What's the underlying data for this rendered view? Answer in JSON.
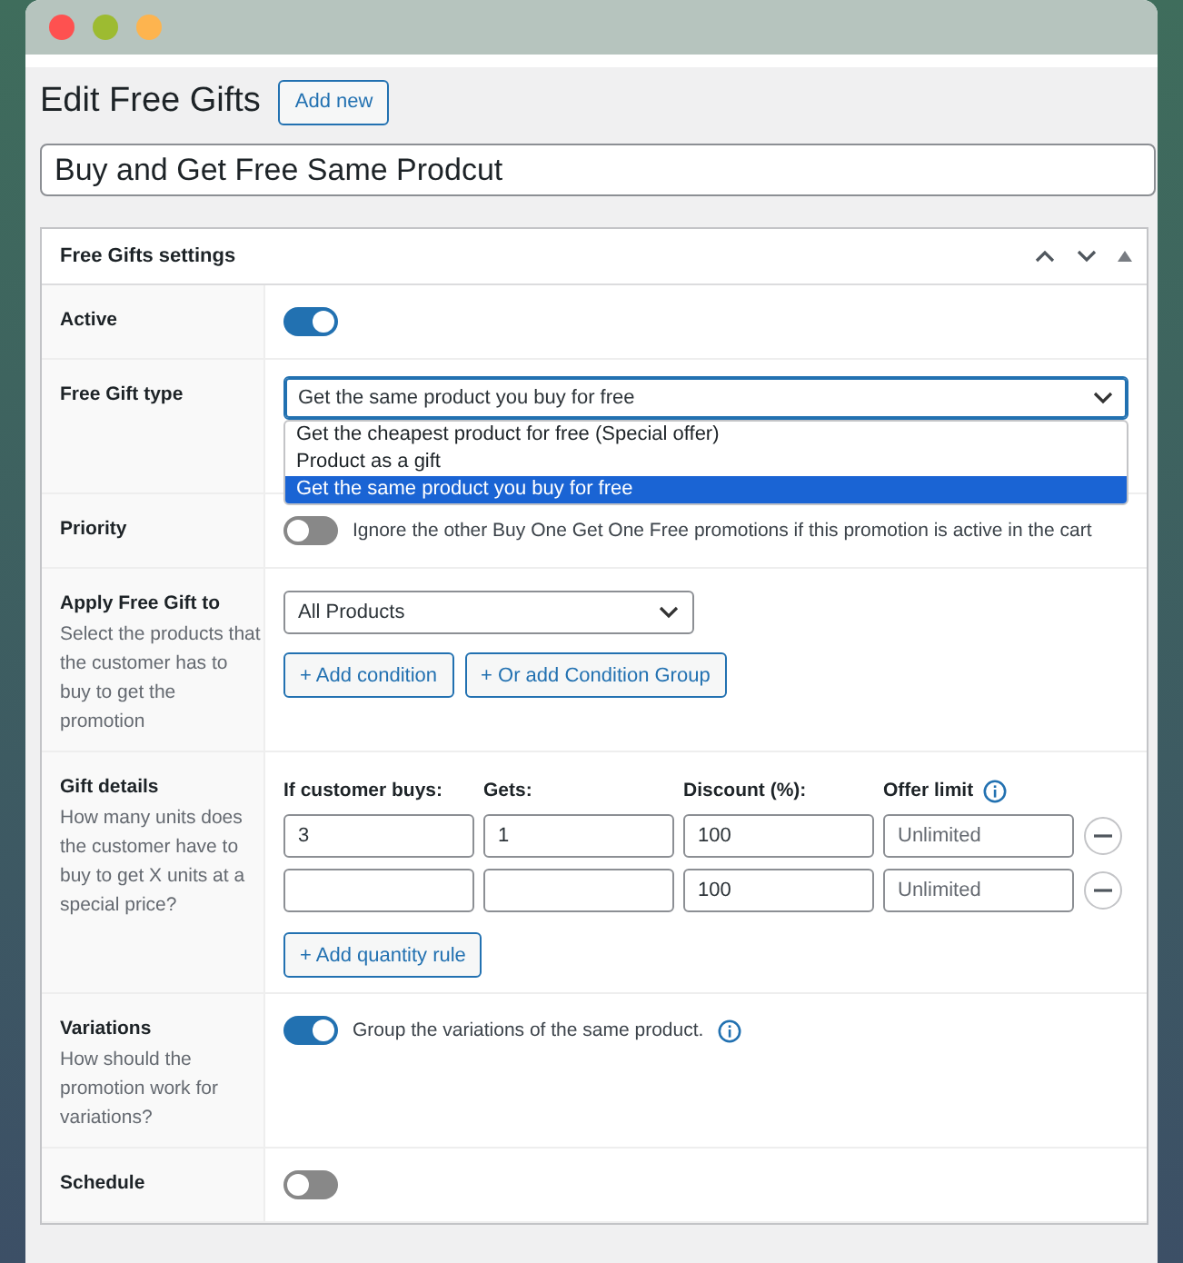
{
  "heading": "Edit Free Gifts",
  "add_new_button": "Add new",
  "post_title": "Buy and Get Free Same Prodcut",
  "settings": {
    "title": "Free Gifts settings",
    "rows": [
      {
        "kind": "toggle",
        "label": "Active",
        "on": true
      },
      {
        "kind": "select",
        "label": "Free Gift type",
        "value": "Get the same product you buy for free",
        "expanded": true,
        "options": [
          {
            "label": "Get the cheapest product for free (Special offer)",
            "selected": false
          },
          {
            "label": "Product as a gift",
            "selected": false
          },
          {
            "label": "Get the same product you buy for free",
            "selected": true
          }
        ]
      },
      {
        "kind": "toggle",
        "label": "Priority",
        "on": false,
        "text": "Ignore the other Buy One Get One Free promotions if this promotion is active in the cart"
      },
      {
        "kind": "conditions",
        "label": "Apply Free Gift to",
        "description": "Select the products that the customer has to buy to get the promotion",
        "select": "All Products",
        "buttons": [
          "+ Add condition",
          "+ Or add Condition Group"
        ]
      },
      {
        "kind": "rules",
        "label": "Gift details",
        "description": "How many units does the customer have to buy to get X units at a special price?",
        "columns": [
          {
            "label": "If customer buys:",
            "info": false
          },
          {
            "label": "Gets:",
            "info": false
          },
          {
            "label": "Discount (%):",
            "info": false
          },
          {
            "label": "Offer limit",
            "info": true
          }
        ],
        "rules": [
          {
            "buys": "3",
            "gets": "1",
            "discount": "100",
            "limit_placeholder": "Unlimited"
          },
          {
            "discount": "100",
            "limit_placeholder": "Unlimited"
          }
        ],
        "add_button": "+ Add quantity rule"
      },
      {
        "kind": "toggle",
        "label": "Variations",
        "description": "How should the promotion work for variations?",
        "on": true,
        "text": "Group the variations of the same product.",
        "info": true
      },
      {
        "kind": "toggle",
        "label": "Schedule",
        "on": false
      }
    ]
  }
}
